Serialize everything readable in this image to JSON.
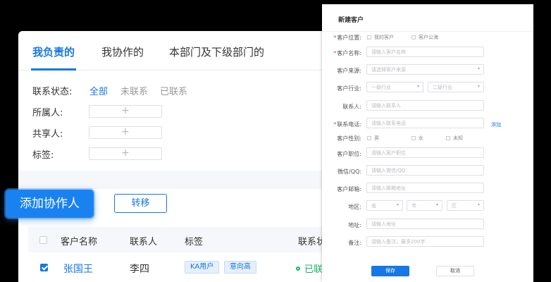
{
  "tabs": [
    "我负责的",
    "我协作的",
    "本部门及下级部门的"
  ],
  "filters": {
    "status_label": "联系状态:",
    "status_options": [
      "全部",
      "未联系",
      "已联系"
    ],
    "owner_label": "所属人:",
    "shared_label": "共享人:",
    "tag_label": "标签:",
    "plus": "+"
  },
  "actions": {
    "add_collaborator": "添加协作人",
    "transfer": "转移"
  },
  "table": {
    "headers": [
      "客户名称",
      "联系人",
      "标签",
      "联系状"
    ],
    "rows": [
      {
        "name": "张国王",
        "contact": "李四",
        "tags": [
          "KA用户",
          "意向高"
        ],
        "status": "已联"
      }
    ]
  },
  "modal": {
    "title": "新建客户",
    "position_label": "客户位置:",
    "position_options": [
      "我的客户",
      "客户公海"
    ],
    "name_label": "客户名称:",
    "name_placeholder": "请输入客户名称",
    "source_label": "客户来源:",
    "source_placeholder": "请选择客户来源",
    "industry_label": "客户行业:",
    "industry_1": "一级行业",
    "industry_2": "二级行业",
    "contact_label": "联系人:",
    "contact_placeholder": "请输入联系人",
    "phone_label": "联系电话:",
    "phone_placeholder": "请输入联系电话",
    "add_link": "添加",
    "gender_label": "客户性别:",
    "gender_options": [
      "男",
      "女",
      "未知"
    ],
    "title_label": "客户职位:",
    "title_placeholder": "请输入客户职位",
    "wechat_label": "微信/QQ:",
    "wechat_placeholder": "请输入微信/QQ",
    "email_label": "客户邮箱:",
    "email_placeholder": "请输入邮箱地址",
    "region_label": "地区:",
    "province": "省",
    "city": "市",
    "district": "区",
    "address_label": "地址:",
    "address_placeholder": "请输入地址",
    "note_label": "备注:",
    "note_placeholder": "请输入备注，最多200字",
    "save": "保存",
    "cancel": "取消"
  }
}
